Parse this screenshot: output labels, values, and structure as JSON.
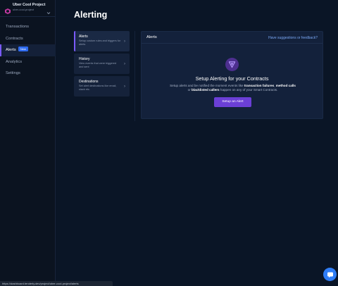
{
  "project": {
    "name": "Uber Cool Project",
    "slug": "uber-cool-project",
    "logo_icon": "project-logo-icon",
    "switcher_icon": "chevron-down-icon"
  },
  "nav": {
    "items": [
      {
        "label": "Transactions"
      },
      {
        "label": "Contracts"
      },
      {
        "label": "Alerts",
        "badge": "New",
        "active": true
      },
      {
        "label": "Analytics"
      },
      {
        "label": "Settings"
      }
    ]
  },
  "page": {
    "title": "Alerting"
  },
  "submenu": {
    "items": [
      {
        "title": "Alerts",
        "desc": "Setup custom rules and triggers for alerts",
        "active": true
      },
      {
        "title": "History",
        "desc": "View events that were triggered and sent"
      },
      {
        "title": "Destinations",
        "desc": "Set alert destinations like email, slack etc."
      }
    ]
  },
  "panel": {
    "title": "Alerts",
    "feedback_link": "Have suggestions or feedback?",
    "empty_title": "Setup Alerting for your Contracts",
    "desc_prefix": "Setup alerts and be notified the moment events like ",
    "desc_bold_1": "transaction failures",
    "desc_mid_1": ", ",
    "desc_bold_2": "method calls",
    "desc_mid_2": " or ",
    "desc_bold_3": "blacklisted callers",
    "desc_suffix": " happen on any of your Smart Contracts.",
    "button_label": "Setup an Alert",
    "icon": "alert-triangle-icon"
  },
  "status_bar": {
    "url": "https://dashboard.tenderly.dev/project/uber-cool-project/alerts"
  },
  "colors": {
    "accent": "#7a5af8",
    "button": "#6b3fd6",
    "badge": "#2f6bf0",
    "link": "#7aa8f5",
    "chat": "#2f7df6"
  }
}
